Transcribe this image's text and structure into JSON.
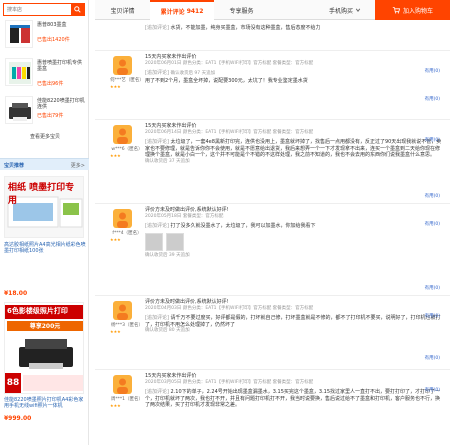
{
  "sidebar": {
    "search_placeholder": "搜本店",
    "products": [
      {
        "name": "惠普803墨盒",
        "sold": "已售出1420件"
      },
      {
        "name": "惠普喷墨打印机专供墨盒",
        "sold": "已售出96件"
      },
      {
        "name": "佳能8220喷墨打印机连供",
        "sold": "已售出79件"
      }
    ],
    "more": "查看更多宝贝",
    "recommend_title": "宝贝推荐",
    "recommend_more": "更多>",
    "ads": [
      {
        "banner": "相纸 喷墨打印专用",
        "desc": "高达胶相纸照片A4高光相片纸彩色喷墨打印相纸100张",
        "price": "¥18.00"
      },
      {
        "banner": "6色影楼级照片打印",
        "sub": "尊享200元",
        "desc": "佳能8220喷墨照片打印机A4彩色家用手机无线wifi照片一体机",
        "price": "¥999.00",
        "badge": "88"
      }
    ]
  },
  "tabs": [
    {
      "label": "宝贝详情"
    },
    {
      "label": "累计评论",
      "count": "9412"
    },
    {
      "label": "专享服务"
    },
    {
      "label": "手机购买"
    }
  ],
  "cart_label": "加入购物车",
  "reviews": [
    {
      "user": "",
      "label": "[追加评论]",
      "text": "水货，不能加墨，纯身买墨盒，市场没有这种墨盒，售后态度不给力",
      "meta": "",
      "useful": "",
      "reply": ""
    },
    {
      "user": "何***艺（匿名）",
      "label": "",
      "text": "15天内买家未作出评价",
      "meta": "2020年06月01日 颜色分类：EAT1【手机WIFI打印】官方标配 套餐类型：官方标配",
      "reply": "有用(0)",
      "extra_label": "[追加评论]",
      "extra_meta": "确认收货后 97 天追加",
      "extra": "用了不到2个月，墨盒全坏掉，说配要300元，太坑了！我专业鉴定墨水货",
      "useful": "有用(0)"
    },
    {
      "user": "w***6（匿名）",
      "label": "",
      "text": "15天内买家未作出评价",
      "meta": "2020年06月14日 颜色分类：EAT1【手机WIFI打印】官方标配 套餐类型：官方标配",
      "reply": "有用(0)",
      "extra_label": "[追加评论]",
      "extra": "太垃圾了，一套4e8黑新打印完，连供也没用上，墨盒就坏掉了，找售后一点用都没有，反正过了90天出现我就说不管，卖家也不要修理，就是告诉你你不会使用，就是不愿意给出退货，我后来想弄一个一下才发现拿不出来，连买一个墨盒到二天给你现在修理换个墨盒，就是小白一个，这个并不可能是个不错的不这样处理，我之前不知道的，我也不会去用的东西你们说我墨盒什么意思。",
      "extra_meta": "确认收货后 37 天追加",
      "useful": "有用(0)"
    },
    {
      "user": "f***4（匿名）",
      "label": "",
      "text": "评价方未及时做出评价,系统默认好评!",
      "meta": "2020年05月18日 套餐类型：官方标配",
      "reply": "有用(0)",
      "extra_label": "[追加评论]",
      "extra": "打了没多久就没墨水了，太垃圾了，我可以加墨水，你加给我看下",
      "extra_meta": "确认收货后 39 天追加",
      "useful": "有用(0)"
    },
    {
      "user": "杨***3（匿名）",
      "label": "",
      "text": "评价方未及时做出评价,系统默认好评!",
      "meta": "2020年04月03日 颜色分类：EAT1【手机WIFI打印】官方标配 套餐类型：官方标配",
      "reply": "有用(0)",
      "extra_label": "[追加评论]",
      "extra": "请千万不要过度买，好评都是假的，打坏就自己修，打坏墨盒就是不修的，都不了打印机不要买，说明好了，打印机也被打了，打印机不用怎么处理掉了，仍然坏了",
      "extra_meta": "确认收货后 80 天追加",
      "useful": "有用(0)"
    },
    {
      "user": "周***1（匿名）",
      "label": "",
      "text": "15天内买家未作出评价",
      "meta": "2020年03月05日 颜色分类：EAT1【手机WIFI打印】官方标配 套餐类型：官方标配",
      "reply": "有用(0)",
      "extra_label": "[追加评论]",
      "extra": "2.10下的单子，2.24号开始出现墨盒漏墨水，3.15买完这个墨盒，3.15找过家里人一直打不出，要打打印了，才打印了一个，打印机就坏了两次，我也打不开，并且有问题打印机打不开，我当时说要换，售后说过给不了墨盒和打印机，客户服务也不行，换了两次结果，买了打印机才发现非常之差。",
      "extra_meta": "",
      "useful": ""
    }
  ]
}
